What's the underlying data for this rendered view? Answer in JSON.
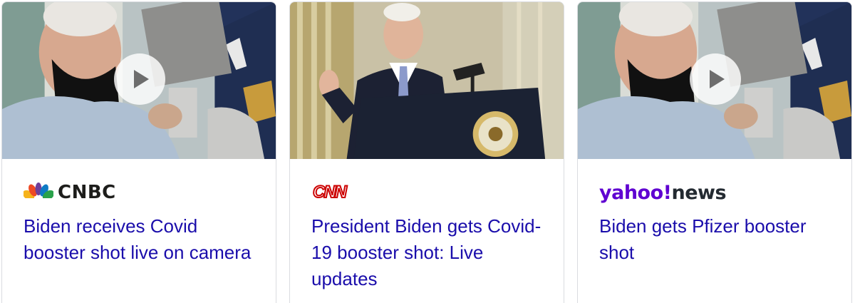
{
  "cards": [
    {
      "source": "CNBC",
      "logo_text": "CNBC",
      "headline": "Biden receives Covid booster shot live on camera",
      "has_video": true
    },
    {
      "source": "CNN",
      "logo_text": "CNN",
      "headline": "President Biden gets Covid-19 booster shot: Live updates",
      "has_video": false
    },
    {
      "source": "Yahoo News",
      "logo_text_brand": "yahoo!",
      "logo_text_suffix": "news",
      "headline": "Biden gets Pfizer booster shot",
      "has_video": true
    }
  ],
  "colors": {
    "headline_link": "#1a0dab",
    "card_border": "#dadce0",
    "cnn_red": "#cc0000",
    "yahoo_purple": "#5f01d1"
  }
}
